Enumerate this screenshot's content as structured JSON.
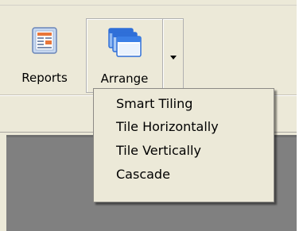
{
  "toolbar": {
    "reports_label": "Reports",
    "arrange_label": "Arrange"
  },
  "arrange_menu": {
    "items": [
      {
        "label": "Smart Tiling"
      },
      {
        "label": "Tile Horizontally"
      },
      {
        "label": "Tile Vertically"
      },
      {
        "label": "Cascade"
      }
    ]
  },
  "icons": {
    "reports": "reports-icon",
    "arrange": "arrange-windows-icon",
    "dropdown": "dropdown-arrow-icon"
  },
  "colors": {
    "toolbar_bg": "#ece9d8",
    "workspace_bg": "#808080",
    "arrange_icon_blue": "#2f6fd8",
    "reports_icon_orange": "#e8763a"
  }
}
